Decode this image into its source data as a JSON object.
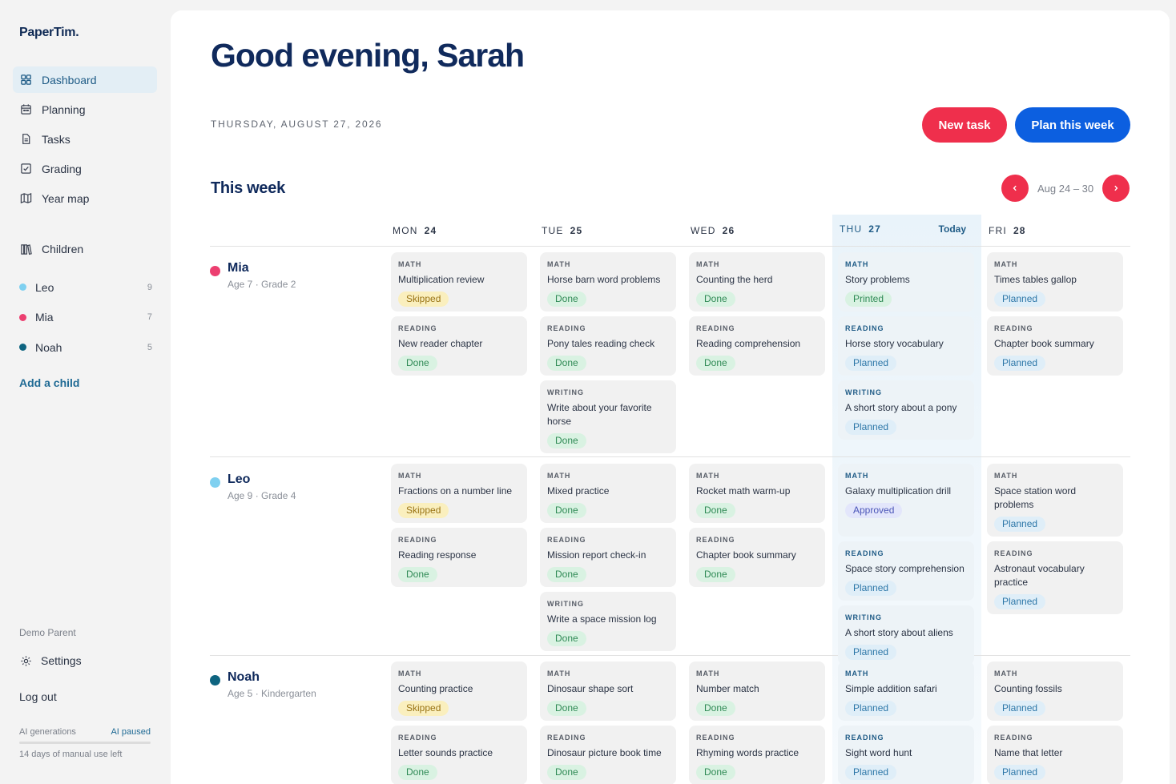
{
  "app": {
    "logo": "PaperTim."
  },
  "sidebar": {
    "nav": [
      {
        "label": "Dashboard",
        "icon": "grid-icon"
      },
      {
        "label": "Planning",
        "icon": "calendar-icon"
      },
      {
        "label": "Tasks",
        "icon": "document-icon"
      },
      {
        "label": "Grading",
        "icon": "checkbox-icon"
      },
      {
        "label": "Year map",
        "icon": "map-icon"
      }
    ],
    "children_label": "Children",
    "children": [
      {
        "name": "Leo",
        "count": "9",
        "color": "#7fd0f0"
      },
      {
        "name": "Mia",
        "count": "7",
        "color": "#ec3f70"
      },
      {
        "name": "Noah",
        "count": "5",
        "color": "#0e6480"
      }
    ],
    "add_child": "Add a child",
    "user": "Demo Parent",
    "settings": "Settings",
    "logout": "Log out",
    "ai_label": "AI generations",
    "ai_status": "AI paused",
    "ai_days": "14 days of manual use left"
  },
  "header": {
    "greeting": "Good evening, Sarah",
    "date": "THURSDAY, AUGUST 27, 2026",
    "new_task": "New task",
    "plan_week": "Plan this week"
  },
  "week": {
    "title": "This week",
    "range": "Aug 24 – 30",
    "today_label": "Today",
    "days": [
      {
        "dow": "MON",
        "num": "24"
      },
      {
        "dow": "TUE",
        "num": "25"
      },
      {
        "dow": "WED",
        "num": "26"
      },
      {
        "dow": "THU",
        "num": "27"
      },
      {
        "dow": "FRI",
        "num": "28"
      }
    ]
  },
  "kids": [
    {
      "name": "Mia",
      "meta": "Age 7 · Grade 2",
      "color": "#ec3f70",
      "days": [
        [
          {
            "s": "MATH",
            "t": "Multiplication review",
            "b": "Skipped"
          },
          {
            "s": "READING",
            "t": "New reader chapter",
            "b": "Done"
          }
        ],
        [
          {
            "s": "MATH",
            "t": "Horse barn word problems",
            "b": "Done"
          },
          {
            "s": "READING",
            "t": "Pony tales reading check",
            "b": "Done"
          },
          {
            "s": "WRITING",
            "t": "Write about your favorite horse",
            "b": "Done"
          }
        ],
        [
          {
            "s": "MATH",
            "t": "Counting the herd",
            "b": "Done"
          },
          {
            "s": "READING",
            "t": "Reading comprehension",
            "b": "Done"
          }
        ],
        [
          {
            "s": "MATH",
            "t": "Story problems",
            "b": "Printed"
          },
          {
            "s": "READING",
            "t": "Horse story vocabulary",
            "b": "Planned"
          },
          {
            "s": "WRITING",
            "t": "A short story about a pony",
            "b": "Planned"
          }
        ],
        [
          {
            "s": "MATH",
            "t": "Times tables gallop",
            "b": "Planned"
          },
          {
            "s": "READING",
            "t": "Chapter book summary",
            "b": "Planned"
          }
        ]
      ]
    },
    {
      "name": "Leo",
      "meta": "Age 9 · Grade 4",
      "color": "#7fd0f0",
      "days": [
        [
          {
            "s": "MATH",
            "t": "Fractions on a number line",
            "b": "Skipped"
          },
          {
            "s": "READING",
            "t": "Reading response",
            "b": "Done"
          }
        ],
        [
          {
            "s": "MATH",
            "t": "Mixed practice",
            "b": "Done"
          },
          {
            "s": "READING",
            "t": "Mission report check-in",
            "b": "Done"
          },
          {
            "s": "WRITING",
            "t": "Write a space mission log",
            "b": "Done"
          }
        ],
        [
          {
            "s": "MATH",
            "t": "Rocket math warm-up",
            "b": "Done"
          },
          {
            "s": "READING",
            "t": "Chapter book summary",
            "b": "Done"
          }
        ],
        [
          {
            "s": "MATH",
            "t": "Galaxy multiplication drill",
            "b": "Approved"
          },
          {
            "s": "READING",
            "t": "Space story comprehension",
            "b": "Planned"
          },
          {
            "s": "WRITING",
            "t": "A short story about aliens",
            "b": "Planned"
          }
        ],
        [
          {
            "s": "MATH",
            "t": "Space station word problems",
            "b": "Planned"
          },
          {
            "s": "READING",
            "t": "Astronaut vocabulary practice",
            "b": "Planned"
          }
        ]
      ]
    },
    {
      "name": "Noah",
      "meta": "Age 5 · Kindergarten",
      "color": "#0e6480",
      "days": [
        [
          {
            "s": "MATH",
            "t": "Counting practice",
            "b": "Skipped"
          },
          {
            "s": "READING",
            "t": "Letter sounds practice",
            "b": "Done"
          }
        ],
        [
          {
            "s": "MATH",
            "t": "Dinosaur shape sort",
            "b": "Done"
          },
          {
            "s": "READING",
            "t": "Dinosaur picture book time",
            "b": "Done"
          }
        ],
        [
          {
            "s": "MATH",
            "t": "Number match",
            "b": "Done"
          },
          {
            "s": "READING",
            "t": "Rhyming words practice",
            "b": "Done"
          }
        ],
        [
          {
            "s": "MATH",
            "t": "Simple addition safari",
            "b": "Planned"
          },
          {
            "s": "READING",
            "t": "Sight word hunt",
            "b": "Planned"
          }
        ],
        [
          {
            "s": "MATH",
            "t": "Counting fossils",
            "b": "Planned"
          },
          {
            "s": "READING",
            "t": "Name that letter",
            "b": "Planned"
          }
        ]
      ]
    }
  ]
}
